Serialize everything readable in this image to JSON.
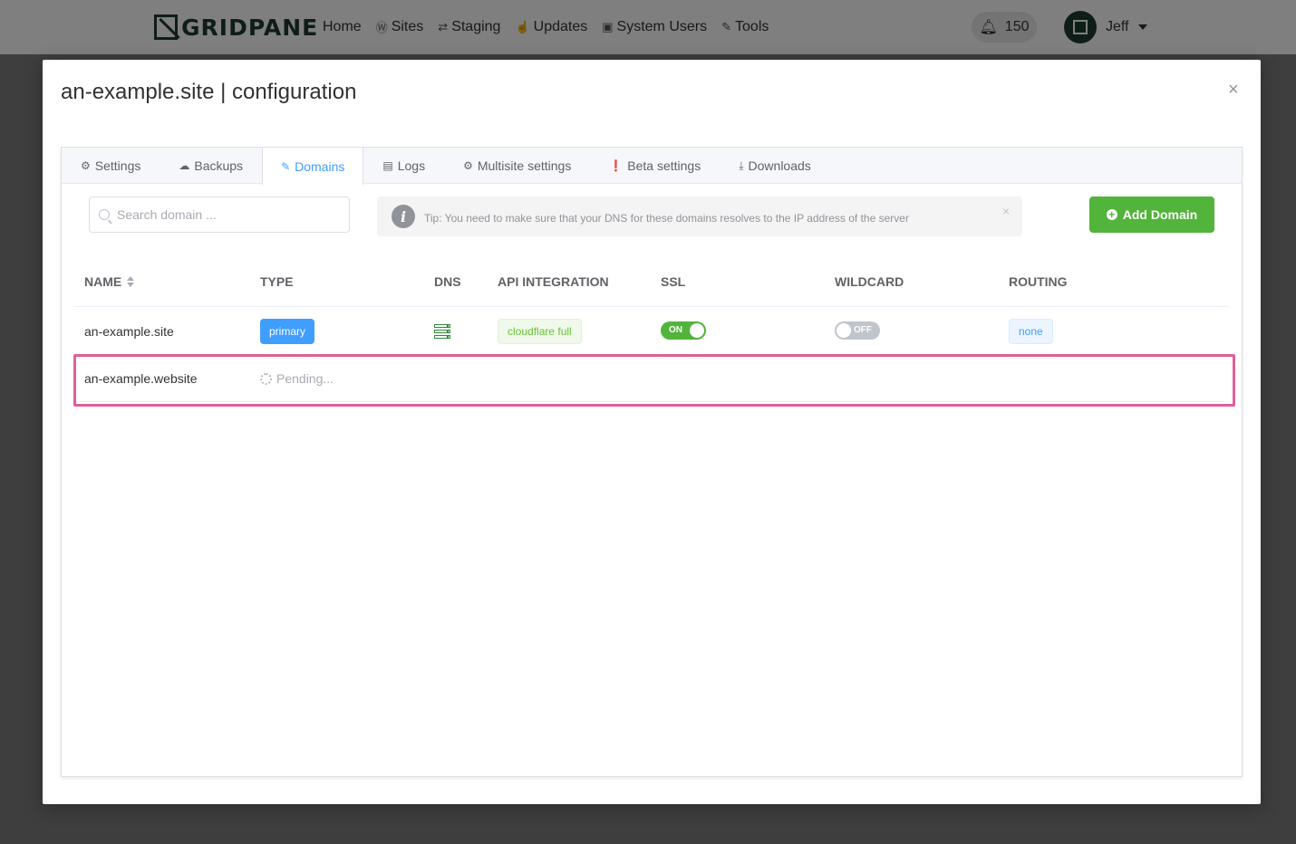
{
  "nav": {
    "logo_text": "GRIDPANE",
    "links": [
      {
        "label": "Home",
        "icon": ""
      },
      {
        "label": "Sites",
        "icon": "wordpress-icon"
      },
      {
        "label": "Staging",
        "icon": "retweet-icon"
      },
      {
        "label": "Updates",
        "icon": "thumbs-up-icon"
      },
      {
        "label": "System Users",
        "icon": "lock-icon"
      },
      {
        "label": "Tools",
        "icon": "wrench-icon"
      }
    ],
    "notifications_count": "150",
    "user_name": "Jeff"
  },
  "modal": {
    "title": "an-example.site | configuration",
    "close_label": "×",
    "tabs": [
      {
        "label": "Settings",
        "icon": "gear-icon",
        "active": false
      },
      {
        "label": "Backups",
        "icon": "cloud-upload-icon",
        "active": false
      },
      {
        "label": "Domains",
        "icon": "edit-icon",
        "active": true
      },
      {
        "label": "Logs",
        "icon": "document-icon",
        "active": false
      },
      {
        "label": "Multisite settings",
        "icon": "gear-icon",
        "active": false
      },
      {
        "label": "Beta settings",
        "icon": "alert-circle-icon",
        "active": false
      },
      {
        "label": "Downloads",
        "icon": "download-icon",
        "active": false
      }
    ],
    "search_placeholder": "Search domain ...",
    "tip": {
      "text": "Tip: You need to make sure that your DNS for these domains resolves to the IP address of the server",
      "close_label": "×"
    },
    "add_button_label": "Add Domain",
    "table": {
      "headers": [
        "NAME",
        "TYPE",
        "DNS",
        "API INTEGRATION",
        "SSL",
        "WILDCARD",
        "ROUTING"
      ],
      "rows": [
        {
          "name": "an-example.site",
          "type": "primary",
          "dns": "dns-server-icon",
          "api_integration": "cloudflare full",
          "ssl": "ON",
          "wildcard": "OFF",
          "routing": "none"
        },
        {
          "name": "an-example.website",
          "type": "Pending..."
        }
      ]
    }
  },
  "colors": {
    "accent": "#409eff",
    "success": "#52b43a",
    "highlight": "#e0609a"
  }
}
